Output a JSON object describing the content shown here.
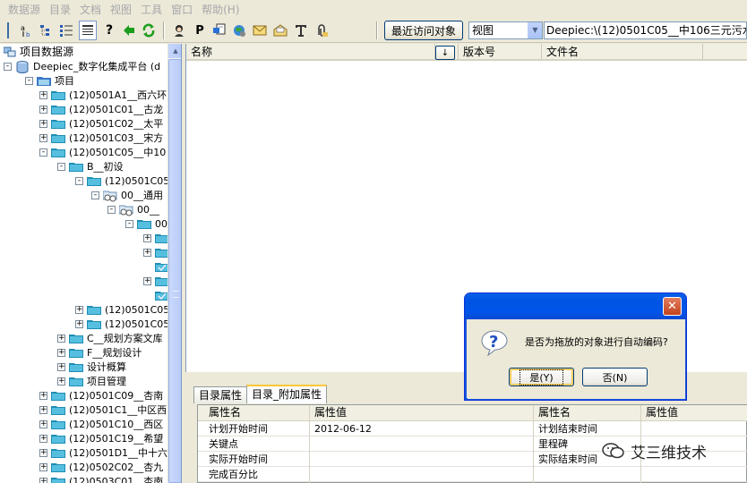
{
  "menu": [
    "数据源",
    "目录",
    "文档",
    "视图",
    "工具",
    "窗口",
    "帮助(H)"
  ],
  "toolbar": {
    "p_label": "P",
    "recent_button": "最近访问对象",
    "view_select": "视图",
    "path": "Deepiec:\\(12)0501C05__中106三元污水"
  },
  "tree": {
    "header": "项目数据源",
    "rows": [
      {
        "label": "Deepiec_数字化集成平台 (d",
        "icon": "database-icon"
      },
      {
        "label": "项目",
        "icon": "project-folder-icon"
      },
      {
        "label": "(12)0501A1__西六环",
        "icon": "folder-icon"
      },
      {
        "label": "(12)0501C01__古龙",
        "icon": "folder-icon"
      },
      {
        "label": "(12)0501C02__太平",
        "icon": "folder-icon"
      },
      {
        "label": "(12)0501C03__宋方",
        "icon": "folder-icon"
      },
      {
        "label": "(12)0501C05__中10",
        "icon": "folder-icon"
      },
      {
        "label": "B__初设",
        "icon": "folder-icon"
      },
      {
        "label": "(12)0501C05",
        "icon": "folder-icon"
      },
      {
        "label": "00__通用",
        "icon": "network-folder-icon"
      },
      {
        "label": "00__",
        "icon": "network-folder-icon"
      },
      {
        "label": "00",
        "icon": "folder-icon"
      },
      {
        "label": "",
        "icon": "folder-icon"
      },
      {
        "label": "",
        "icon": "folder-icon"
      },
      {
        "label": "",
        "icon": "folder-check-icon"
      },
      {
        "label": "",
        "icon": "folder-icon"
      },
      {
        "label": "",
        "icon": "folder-check-icon"
      },
      {
        "label": "(12)0501C05",
        "icon": "folder-icon"
      },
      {
        "label": "(12)0501C05",
        "icon": "folder-icon"
      },
      {
        "label": "C__规划方案文库",
        "icon": "folder-icon"
      },
      {
        "label": "F__规划设计",
        "icon": "folder-icon"
      },
      {
        "label": "设计概算",
        "icon": "folder-icon"
      },
      {
        "label": "项目管理",
        "icon": "folder-icon"
      },
      {
        "label": "(12)0501C09__杏南",
        "icon": "folder-icon"
      },
      {
        "label": "(12)0501C1__中区西",
        "icon": "folder-icon"
      },
      {
        "label": "(12)0501C10__西区",
        "icon": "folder-icon"
      },
      {
        "label": "(12)0501C19__希望",
        "icon": "folder-icon"
      },
      {
        "label": "(12)0501D1__中十六",
        "icon": "folder-icon"
      },
      {
        "label": "(12)0502C02__杏九",
        "icon": "folder-icon"
      },
      {
        "label": "(12)0503C01__杏南",
        "icon": "folder-icon"
      }
    ]
  },
  "list": {
    "columns": [
      "名称",
      "版本号",
      "文件名"
    ],
    "sort_glyph": "↓"
  },
  "props": {
    "tabs": [
      "目录属性",
      "目录_附加属性"
    ],
    "active_tab": 1,
    "headers": [
      "属性名",
      "属性值",
      "属性名",
      "属性值"
    ],
    "rows": [
      [
        "计划开始时间",
        "2012-06-12",
        "计划结束时间",
        ""
      ],
      [
        "关键点",
        "",
        "里程碑",
        ""
      ],
      [
        "实际开始时间",
        "",
        "实际结束时间",
        ""
      ],
      [
        "完成百分比",
        "",
        "",
        ""
      ]
    ]
  },
  "dialog": {
    "message": "是否为拖放的对象进行自动编码?",
    "yes": "是(Y)",
    "no": "否(N)",
    "close": "✕"
  },
  "watermark": "艾三维技术",
  "colors": {
    "title_blue": "#0054e3",
    "folder_cyan": "#3fb5d8",
    "tab_highlight": "#ffc83c"
  }
}
